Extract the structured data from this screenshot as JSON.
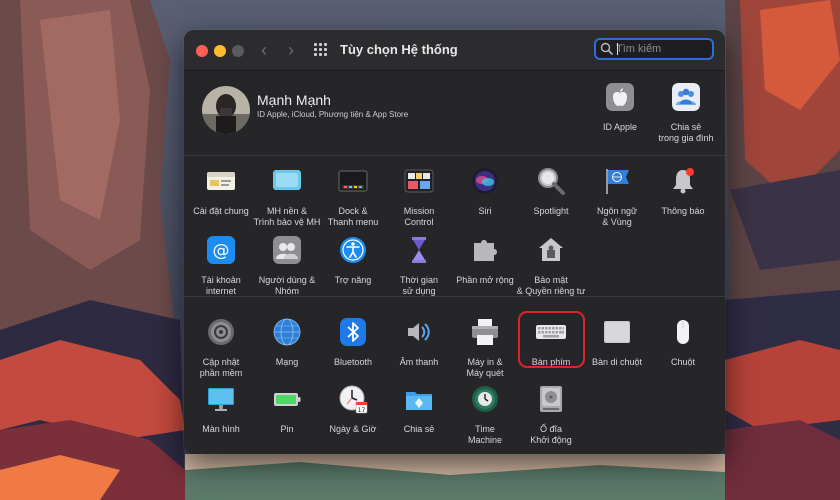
{
  "window": {
    "title": "Tùy chọn Hệ thống",
    "search_placeholder": "Tìm kiếm"
  },
  "account": {
    "name": "Mạnh Mạnh",
    "subtitle": "ID Apple, iCloud, Phương tiện & App Store",
    "items": [
      {
        "label": "ID Apple",
        "icon": "apple-icon"
      },
      {
        "label": "Chia sẻ\ntrong gia đình",
        "icon": "family-sharing-icon"
      }
    ]
  },
  "rows": [
    [
      {
        "label": "Cài đặt chung",
        "icon": "general-icon"
      },
      {
        "label": "MH nền &\nTrình bảo vệ MH",
        "icon": "desktop-screensaver-icon"
      },
      {
        "label": "Dock &\nThanh menu",
        "icon": "dock-icon"
      },
      {
        "label": "Mission\nControl",
        "icon": "mission-control-icon"
      },
      {
        "label": "Siri",
        "icon": "siri-icon"
      },
      {
        "label": "Spotlight",
        "icon": "spotlight-icon"
      },
      {
        "label": "Ngôn ngữ\n& Vùng",
        "icon": "language-region-icon"
      },
      {
        "label": "Thông báo",
        "icon": "notifications-icon"
      }
    ],
    [
      {
        "label": "Tài khoản\ninternet",
        "icon": "internet-accounts-icon"
      },
      {
        "label": "Người dùng &\nNhóm",
        "icon": "users-groups-icon"
      },
      {
        "label": "Trợ năng",
        "icon": "accessibility-icon"
      },
      {
        "label": "Thời gian\nsử dụng",
        "icon": "screen-time-icon"
      },
      {
        "label": "Phần mở rộng",
        "icon": "extensions-icon"
      },
      {
        "label": "Bảo mật\n& Quyền riêng tư",
        "icon": "security-privacy-icon"
      }
    ],
    [
      {
        "label": "Cập nhật\nphần mềm",
        "icon": "software-update-icon"
      },
      {
        "label": "Mạng",
        "icon": "network-icon"
      },
      {
        "label": "Bluetooth",
        "icon": "bluetooth-icon"
      },
      {
        "label": "Âm thanh",
        "icon": "sound-icon"
      },
      {
        "label": "Máy in &\nMáy quét",
        "icon": "printers-scanners-icon"
      },
      {
        "label": "Bàn phím",
        "icon": "keyboard-icon"
      },
      {
        "label": "Bàn di chuột",
        "icon": "trackpad-icon"
      },
      {
        "label": "Chuột",
        "icon": "mouse-icon"
      }
    ],
    [
      {
        "label": "Màn hình",
        "icon": "displays-icon"
      },
      {
        "label": "Pin",
        "icon": "battery-icon"
      },
      {
        "label": "Ngày & Giờ",
        "icon": "date-time-icon",
        "badge": "17"
      },
      {
        "label": "Chia sẻ",
        "icon": "sharing-icon"
      },
      {
        "label": "Time\nMachine",
        "icon": "time-machine-icon"
      },
      {
        "label": "Ổ đĩa\nKhởi động",
        "icon": "startup-disk-icon"
      }
    ]
  ],
  "highlighted_item": "Bàn phím",
  "colors": {
    "window_bg": "#262628",
    "highlight": "#d9262b",
    "search_focus": "#2f6ed6"
  }
}
